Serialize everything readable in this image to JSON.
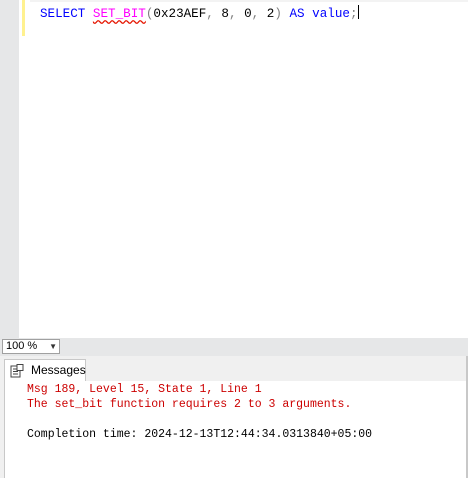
{
  "editor": {
    "query_tokens": {
      "select": "SELECT",
      "func": "SET_BIT",
      "open_paren": "(",
      "arg1": "0x23AEF",
      "comma1": ",",
      "arg2": "8",
      "comma2": ",",
      "arg3": "0",
      "comma3": ",",
      "arg4": "2",
      "close_paren": ")",
      "as": "AS",
      "alias": "value",
      "semicolon": ";"
    }
  },
  "zoom": {
    "value": "100 %"
  },
  "results": {
    "tab_label": "Messages",
    "messages": {
      "line1": "Msg 189, Level 15, State 1, Line 1",
      "line2": "The set_bit function requires 2 to 3 arguments.",
      "line3": "Completion time: 2024-12-13T12:44:34.0313840+05:00"
    }
  },
  "colors": {
    "keyword": "#0000ff",
    "function": "#ff00ff",
    "operator": "#808080",
    "error_text": "#cc0000",
    "editor_margin": "#e6e7e8"
  },
  "icons": {
    "messages_tab_icon": "messages-icon",
    "zoom_dropdown_icon": "chevron-down-icon"
  }
}
